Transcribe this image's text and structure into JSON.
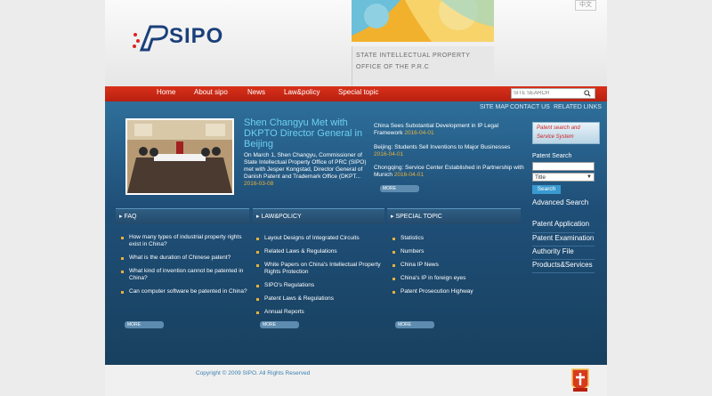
{
  "header": {
    "lang_switch": "中文",
    "logo_text": "SIPO",
    "agency_line1": "STATE INTELLECTUAL PROPERTY",
    "agency_line2": "OFFICE OF THE P.R.C"
  },
  "nav": {
    "items": [
      "Home",
      "About sipo",
      "News",
      "Law&policy",
      "Special topic"
    ],
    "search_placeholder": "SITE SEARCH"
  },
  "top_links": [
    "SITE MAP",
    "CONTACT US",
    "RELATED LINKS"
  ],
  "feature": {
    "headline": "Shen Changyu Met with DKPTO Director General in Beijing",
    "body": "On March 1, Shen Changyu, Commissioner of State Intellectual Property Office of PRC (SIPO) met with Jesper Kongstad, Director General of Danish Patent and Trademark Office (DKPT...",
    "date": "2016-03-08"
  },
  "news": [
    {
      "title": "China Sees Substantial Development in IP Legal Framework",
      "date": "2016-04-01"
    },
    {
      "title": "Beijing: Students Sell Inventions to Major Businesses",
      "date": "2016-04-01"
    },
    {
      "title": "Chongqing: Service Center Established in Partnership with Munich",
      "date": "2016-04-01"
    }
  ],
  "more_label": "MORE",
  "faq": {
    "title": "FAQ",
    "items": [
      "How many types of industrial property rights exist in China?",
      "What is the duration of Chinese patent?",
      "What kind of invention cannot be patented in China?",
      "Can computer software be patented in China?"
    ]
  },
  "law": {
    "title": "LAW&POLICY",
    "items": [
      "Layout Designs of Integrated Circuits",
      "Related Laws & Regulations",
      "White Papers on China's Intellectual Property Rights Protection",
      "SIPO's Regulations",
      "Patent Laws & Regulations",
      "Annual Reports"
    ]
  },
  "special": {
    "title": "SPECIAL TOPIC",
    "items": [
      "Statistics",
      "Numbers",
      "China IP News",
      "China's IP in foreign eyes",
      "Patent Prosecution Highway"
    ]
  },
  "sidebar": {
    "promo_line1": "Patent search and",
    "promo_line2": "Service System",
    "patent_search_label": "Patent Search",
    "select_value": "Title",
    "search_button": "Search",
    "advanced": "Advanced Search",
    "links": [
      "Patent Application",
      "Patent Examination",
      "Authority File",
      "Products&Services"
    ]
  },
  "footer": {
    "copyright": "Copyright © 2009 SIPO. All Rights Reserved"
  }
}
